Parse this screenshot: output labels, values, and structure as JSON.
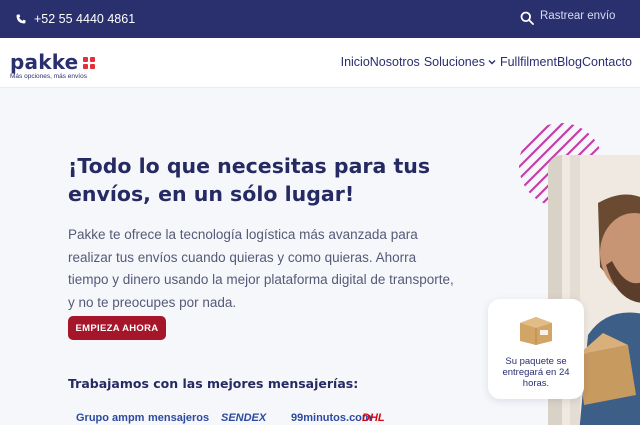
{
  "topbar": {
    "phone": "+52 55 4440 4861",
    "track_placeholder": "Rastrear envío"
  },
  "brand": {
    "name": "pakke",
    "tagline": "Más opciones, más envíos",
    "dot_color": "#e0303a",
    "primary_color": "#2a2f6e"
  },
  "nav": {
    "items": [
      {
        "label": "Inicio"
      },
      {
        "label": "Nosotros"
      },
      {
        "label": "Soluciones",
        "has_dropdown": true
      },
      {
        "label": "Fullfilment"
      },
      {
        "label": "Blog"
      },
      {
        "label": "Contacto"
      }
    ]
  },
  "hero": {
    "title": "¡Todo lo que necesitas para tus envíos, en un sólo lugar!",
    "body": "Pakke te ofrece la tecnología logística más avanzada para realizar tus envíos cuando quieras y como quieras. Ahorra tiempo y dinero usando la mejor plataforma digital de transporte, y no te preocupes por nada.",
    "cta": "EMPIEZA AHORA",
    "cta_color": "#a5162b"
  },
  "badge": {
    "text": "Su paquete se entregará en 24 horas.",
    "icon": "package-box-icon"
  },
  "carriers": {
    "title": "Trabajamos con las mejores mensajerías:",
    "logos": [
      "Grupo ampm",
      "mensajeros",
      "SENDEX",
      "99minutos.com",
      "DHL"
    ]
  }
}
